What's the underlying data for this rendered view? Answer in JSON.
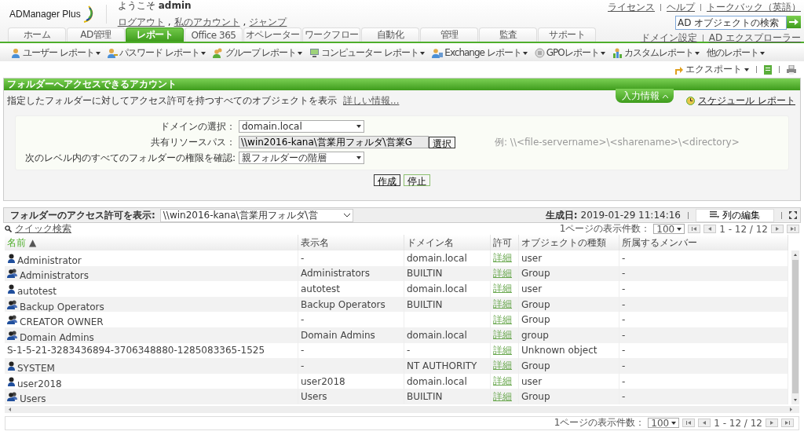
{
  "header": {
    "logo": "ADManager Plus",
    "welcome": "ようこそ",
    "user": "admin",
    "user_link_separator": ",",
    "user_links": [
      "ログアウト",
      "私のアカウント",
      "ジャンプ"
    ],
    "top_links": [
      "ライセンス",
      "ヘルプ",
      "トークバック（英語）"
    ],
    "search": {
      "placeholder": "AD オブジェクトの検索"
    },
    "domain_links": [
      "ドメイン設定",
      "AD エクスプローラー"
    ]
  },
  "tabs": [
    {
      "label": "ホーム",
      "selected": false
    },
    {
      "label": "AD管理",
      "selected": false
    },
    {
      "label": "レポート",
      "selected": true
    },
    {
      "label": "Office 365",
      "selected": false
    },
    {
      "label": "オペレーター",
      "selected": false
    },
    {
      "label": "ワークフロー",
      "selected": false
    },
    {
      "label": "自動化",
      "selected": false
    },
    {
      "label": "管理",
      "selected": false
    },
    {
      "label": "監査",
      "selected": false
    },
    {
      "label": "サポート",
      "selected": false
    }
  ],
  "subnav": [
    {
      "label": "ユーザー レポート",
      "kind": "user"
    },
    {
      "label": "パスワード レポート",
      "kind": "key"
    },
    {
      "label": "グループ レポート",
      "kind": "group"
    },
    {
      "label": "コンピューター レポート",
      "kind": "computer"
    },
    {
      "label": "Exchange レポート",
      "kind": "exchange"
    },
    {
      "label": "GPOレポート",
      "kind": "gpo"
    },
    {
      "label": "カスタムレポート",
      "kind": "custom"
    },
    {
      "label": "他のレポート",
      "kind": "none"
    }
  ],
  "toolbar": {
    "export": "エクスポート"
  },
  "report": {
    "title": "フォルダーへアクセスできるアカウント",
    "description": "指定したフォルダーに対してアクセス許可を持つすべてのオブジェクトを表示",
    "more_link": "詳しい情報...",
    "input_tab": "入力情報",
    "schedule_link": "スケジュール レポート",
    "form": [
      {
        "label": "ドメインの選択：",
        "kind": "select",
        "value": "domain.local"
      },
      {
        "label": "共有リソースパス：",
        "kind": "path",
        "value": "\\\\win2016-kana\\営業用フォルダ\\営業G",
        "button": "選択",
        "example": "例: \\\\<file-servername>\\<sharename>\\<directory>"
      },
      {
        "label": "次のレベル内のすべてのフォルダーの権限を確認:",
        "kind": "select",
        "value": "親フォルダーの階層"
      }
    ],
    "buttons": [
      "作成",
      "停止"
    ]
  },
  "results": {
    "path_label": "フォルダーのアクセス許可を表示:",
    "path_value": "\\\\win2016-kana\\営業用フォルダ\\営",
    "generated_label": "生成日:",
    "generated_value": "2019-01-29 11:14:16",
    "edit_columns": "列の編集",
    "quick_search": "クイック検索",
    "pager_top": {
      "per_page_label": "1ページの表示件数：",
      "per_page": "100",
      "range": "1 - 12 /  12"
    },
    "pager_bottom": {
      "per_page_label": "1ページの表示件数：",
      "per_page": "100",
      "range": "1 - 12 /  12"
    },
    "sort_indicator": "▲",
    "columns": [
      {
        "label": "名前",
        "sorted": true
      },
      {
        "label": "表示名",
        "sorted": false
      },
      {
        "label": "ドメイン名",
        "sorted": false
      },
      {
        "label": "許可",
        "sorted": false
      },
      {
        "label": "オブジェクトの種類",
        "sorted": false
      },
      {
        "label": "所属するメンバー",
        "sorted": false
      }
    ],
    "rows": [
      {
        "kind": "user",
        "name": "Administrator",
        "display": "-",
        "domain": "domain.local",
        "permission": "詳細",
        "type": "user",
        "members": "-"
      },
      {
        "kind": "group",
        "name": "Administrators",
        "display": "Administrators",
        "domain": "BUILTIN",
        "permission": "詳細",
        "type": "Group",
        "members": "-"
      },
      {
        "kind": "user",
        "name": "autotest",
        "display": "autotest",
        "domain": "domain.local",
        "permission": "詳細",
        "type": "user",
        "members": "-"
      },
      {
        "kind": "group",
        "name": "Backup Operators",
        "display": "Backup Operators",
        "domain": "BUILTIN",
        "permission": "詳細",
        "type": "Group",
        "members": "-"
      },
      {
        "kind": "group",
        "name": "CREATOR OWNER",
        "display": "-",
        "domain": "",
        "permission": "詳細",
        "type": "Group",
        "members": "-"
      },
      {
        "kind": "group",
        "name": "Domain Admins",
        "display": "Domain Admins",
        "domain": "domain.local",
        "permission": "詳細",
        "type": "group",
        "members": "-"
      },
      {
        "kind": "none",
        "name": "S-1-5-21-3283436894-3706348880-1285083365-1525",
        "display": "-",
        "domain": "-",
        "permission": "詳細",
        "type": "Unknown object",
        "members": "-"
      },
      {
        "kind": "user",
        "name": "SYSTEM",
        "display": "-",
        "domain": "NT AUTHORITY",
        "permission": "詳細",
        "type": "Group",
        "members": "-"
      },
      {
        "kind": "user",
        "name": "user2018",
        "display": "user2018",
        "domain": "domain.local",
        "permission": "詳細",
        "type": "user",
        "members": "-"
      },
      {
        "kind": "group",
        "name": "Users",
        "display": "Users",
        "domain": "BUILTIN",
        "permission": "詳細",
        "type": "Group",
        "members": "-"
      }
    ]
  }
}
